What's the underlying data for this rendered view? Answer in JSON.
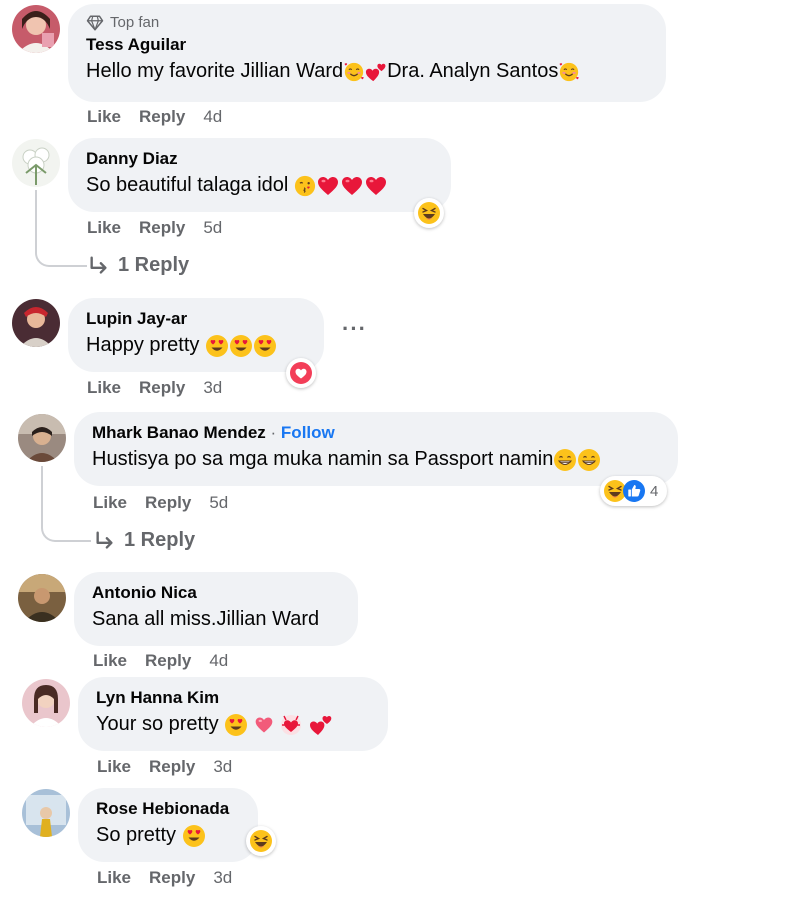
{
  "comments": [
    {
      "badge": "Top fan",
      "name": "Tess Aguilar",
      "text_parts": [
        "Hello my favorite Jillian Ward",
        "Dra. Analyn Santos"
      ],
      "like": "Like",
      "reply": "Reply",
      "time": "4d",
      "avatar_color": "#b84a5a"
    },
    {
      "name": "Danny Diaz",
      "text": "So beautiful talaga idol",
      "like": "Like",
      "reply": "Reply",
      "time": "5d",
      "replies": "1 Reply",
      "avatar_color": "#dfe6dc"
    },
    {
      "name": "Lupin Jay-ar",
      "text": "Happy pretty",
      "like": "Like",
      "reply": "Reply",
      "time": "3d",
      "avatar_color": "#5a3a40"
    },
    {
      "name": "Mhark Banao Mendez",
      "follow": "Follow",
      "text": "Hustisya po sa mga muka namin sa Passport namin",
      "like": "Like",
      "reply": "Reply",
      "time": "5d",
      "reaction_count": "4",
      "replies": "1 Reply",
      "avatar_color": "#7a6a5e"
    },
    {
      "name": "Antonio Nica",
      "text": "Sana all miss.Jillian Ward",
      "like": "Like",
      "reply": "Reply",
      "time": "4d",
      "avatar_color": "#8a7050"
    },
    {
      "name": "Lyn Hanna Kim",
      "text": "Your so pretty",
      "like": "Like",
      "reply": "Reply",
      "time": "3d",
      "avatar_color": "#d8a0a8"
    },
    {
      "name": "Rose Hebionada",
      "text": "So pretty",
      "like": "Like",
      "reply": "Reply",
      "time": "3d",
      "avatar_color": "#8aa8c8"
    }
  ],
  "colors": {
    "bubble": "#f0f2f5",
    "meta_text": "#65676b",
    "link_blue": "#1877f2",
    "heart_red": "#f02849"
  }
}
